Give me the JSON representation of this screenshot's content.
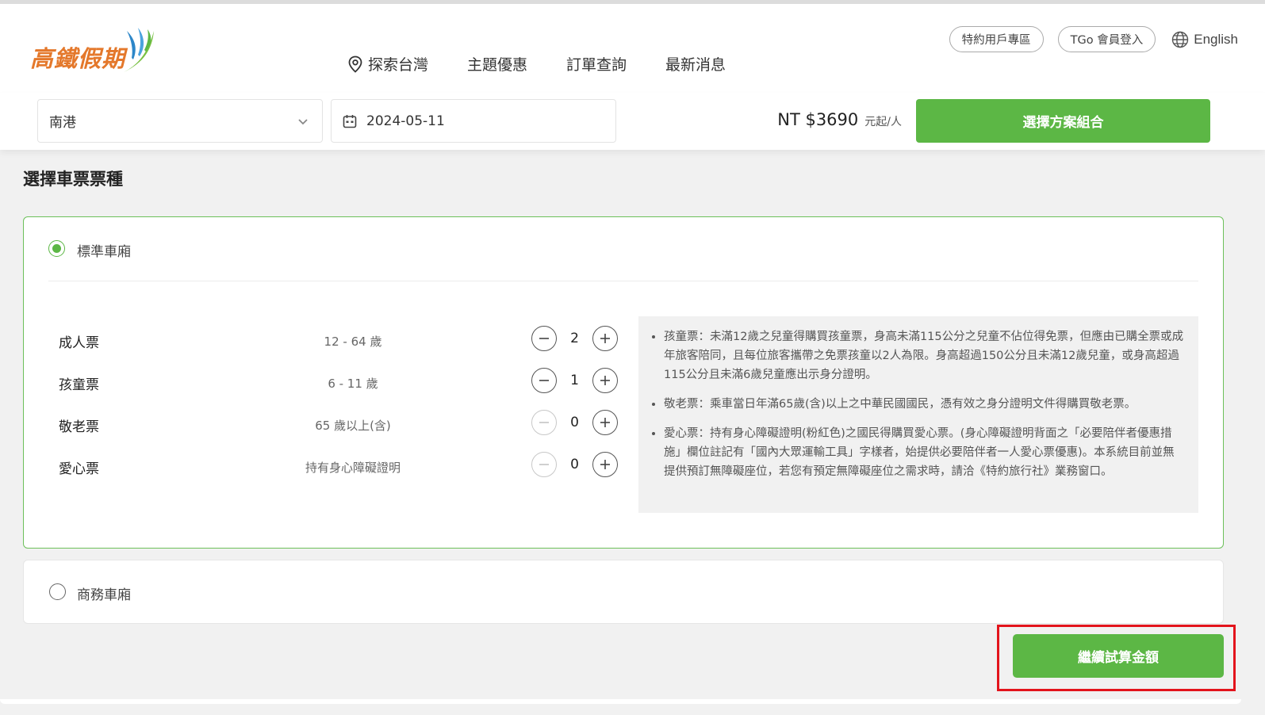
{
  "header": {
    "logo_text": "高鐵假期",
    "nav": [
      "探索台灣",
      "主題優惠",
      "訂單查詢",
      "最新消息"
    ],
    "special_users": "特約用戶專區",
    "member_login": "TGo 會員登入",
    "language": "English"
  },
  "search": {
    "station": "南港",
    "date": "2024-05-11",
    "price": "NT $3690",
    "price_unit": "元起/人",
    "choose_button": "選擇方案組合"
  },
  "section_title": "選擇車票票種",
  "standard_car": {
    "label": "標準車廂",
    "selected": true,
    "tickets": [
      {
        "name": "成人票",
        "age": "12 - 64 歲",
        "qty": "2"
      },
      {
        "name": "孩童票",
        "age": "6 - 11 歲",
        "qty": "1"
      },
      {
        "name": "敬老票",
        "age": "65 歲以上(含)",
        "qty": "0"
      },
      {
        "name": "愛心票",
        "age": "持有身心障礙證明",
        "qty": "0"
      }
    ],
    "notes": [
      "孩童票：未滿12歲之兒童得購買孩童票，身高未滿115公分之兒童不佔位得免票，但應由已購全票或成年旅客陪同，且每位旅客攜帶之免票孩童以2人為限。身高超過150公分且未滿12歲兒童，或身高超過115公分且未滿6歲兒童應出示身分證明。",
      "敬老票：乘車當日年滿65歲(含)以上之中華民國國民，憑有效之身分證明文件得購買敬老票。",
      "愛心票：持有身心障礙證明(粉紅色)之國民得購買愛心票。(身心障礙證明背面之「必要陪伴者優惠措施」欄位註記有「國內大眾運輸工具」字樣者，始提供必要陪伴者一人愛心票優惠)。本系統目前並無提供預訂無障礙座位，若您有預定無障礙座位之需求時，請洽《特約旅行社》業務窗口。"
    ]
  },
  "business_car": {
    "label": "商務車廂",
    "selected": false
  },
  "continue_button": "繼續試算金額",
  "colors": {
    "brand_green": "#5cb745",
    "logo_orange": "#e4782b",
    "highlight_red": "#e3141c"
  }
}
